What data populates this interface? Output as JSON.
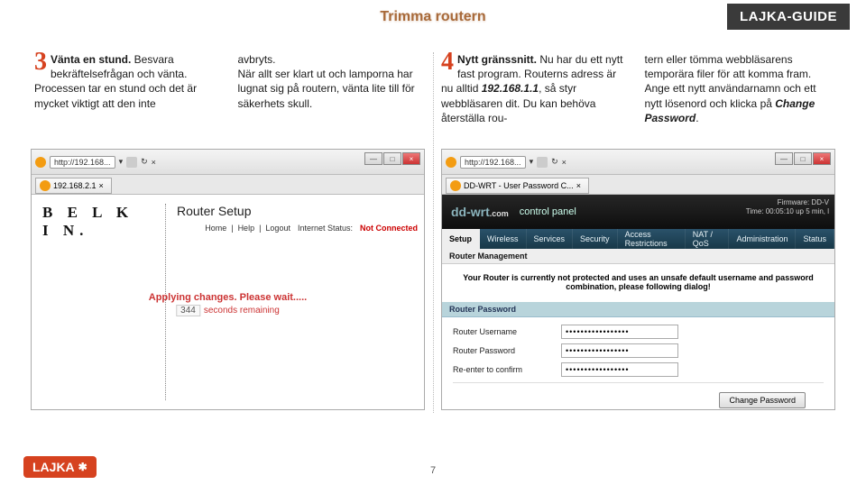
{
  "header": {
    "title": "Trimma routern",
    "badge": "LAJKA-GUIDE"
  },
  "step3": {
    "num": "3",
    "title": "Vänta en stund.",
    "body_a": " Besvara bekräftelsefrågan och vänta. Processen tar en stund och det är mycket viktigt att den inte ",
    "body_b": "avbryts.",
    "body_c": " När allt ser klart ut och lamporna har lugnat sig på routern, vänta lite till för säkerhets skull."
  },
  "step4": {
    "num": "4",
    "title": "Nytt gränssnitt.",
    "body_a": " Nu har du ett nytt fast program. Routerns adress är nu alltid ",
    "ip": "192.168.1.1",
    "body_b": ", så styr webbläsaren dit. Du kan behöva återställa rou-",
    "body_c": "tern eller tömma webbläsarens temporära filer för att komma fram. Ange ett nytt användarnamn och ett nytt lösenord och klicka på ",
    "action": "Change Password",
    "body_d": "."
  },
  "belkin": {
    "url": "http://192.168...",
    "tab": "192.168.2.1",
    "logo": "B E L K I N.",
    "router_setup": "Router Setup",
    "nav_home": "Home",
    "nav_help": "Help",
    "nav_logout": "Logout",
    "nav_status_lbl": "Internet Status:",
    "nav_status_val": "Not Connected",
    "applying": "Applying changes. Please wait.....",
    "count": "344",
    "remaining": "seconds remaining"
  },
  "ddwrt": {
    "url": "http://192.168...",
    "tab": "DD-WRT - User Password C...",
    "logo_l": "dd-wrt",
    "logo_r": ".com",
    "cp": "control panel",
    "fw1": "Firmware: DD-V",
    "fw2": "Time: 00:05:10 up 5 min, l",
    "nav": [
      "Setup",
      "Wireless",
      "Services",
      "Security",
      "Access Restrictions",
      "NAT / QoS",
      "Administration",
      "Status"
    ],
    "subhead": "Router Management",
    "warning": "Your Router is currently not protected and uses an unsafe default username and password combination, please following dialog!",
    "sechead": "Router Password",
    "f_user": "Router Username",
    "f_pass": "Router Password",
    "f_conf": "Re-enter to confirm",
    "dots": "•••••••••••••••••",
    "btn": "Change Password"
  },
  "footer": {
    "logo": "LAJKA",
    "sym": "✱",
    "page": "7"
  }
}
